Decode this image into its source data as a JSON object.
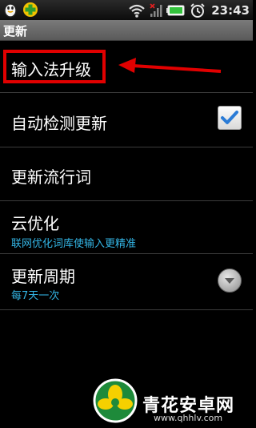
{
  "status_bar": {
    "left_icons": [
      "qq-penguin-icon",
      "green-plus-app-icon"
    ],
    "right_icons": [
      "wifi-icon",
      "signal-bars-icon",
      "battery-icon",
      "alarm-clock-icon"
    ],
    "time": "23:43"
  },
  "title_bar": {
    "title": "更新"
  },
  "settings": {
    "upgrade": {
      "label": "输入法升级"
    },
    "auto_update": {
      "label": "自动检测更新",
      "checked": true
    },
    "update_words": {
      "label": "更新流行词"
    },
    "cloud_optimize": {
      "label": "云优化",
      "summary": "联网优化词库使输入更精准"
    },
    "update_cycle": {
      "label": "更新周期",
      "summary": "每7天一次"
    }
  },
  "annotation": {
    "color": "#e10000"
  },
  "accent_color": "#33b5e5",
  "watermark": {
    "text": "青花安卓网",
    "url": "www.qhhlv.com"
  }
}
